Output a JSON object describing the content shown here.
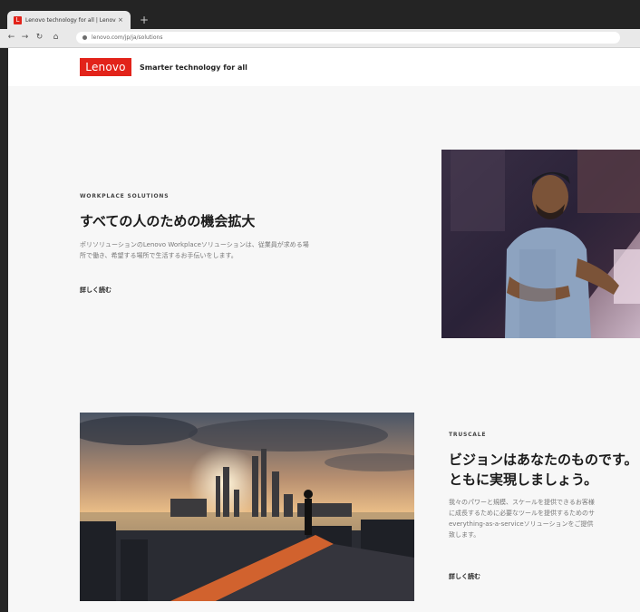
{
  "browser": {
    "tab_title": "Lenovo technology for all | Lenovo",
    "tab_close": "×",
    "new_tab": "+",
    "url": "lenovo.com/jp/ja/solutions"
  },
  "header": {
    "logo_text": "Lenovo",
    "tagline": "Smarter technology for all"
  },
  "section1": {
    "eyebrow": "WORKPLACE SOLUTIONS",
    "title": "すべての人のための機会拡大",
    "body_lines": [
      "ポリソリューションのLenovo Workplaceソリューションは、従業員が求める場",
      "所で働き、希望する場所で生活するお手伝いをします。"
    ],
    "link": "詳しく読む"
  },
  "section2": {
    "eyebrow": "TRUSCALE",
    "title_lines": [
      "ビジョンはあなたのものです。",
      "ともに実現しましょう。"
    ],
    "body_lines": [
      "我々のパワーと規模、スケールを提供できるお客様",
      "に成長するために必要なツールを提供するためのサ",
      "everything-as-a-serviceソリューションをご提供",
      "致します。"
    ],
    "link": "詳しく読む"
  },
  "icons": {
    "back": "back-arrow-icon",
    "forward": "forward-arrow-icon",
    "reload": "reload-icon",
    "home": "home-icon",
    "lock": "lock-icon"
  },
  "colors": {
    "brand": "#e2231a",
    "page_bg": "#f7f7f7"
  }
}
